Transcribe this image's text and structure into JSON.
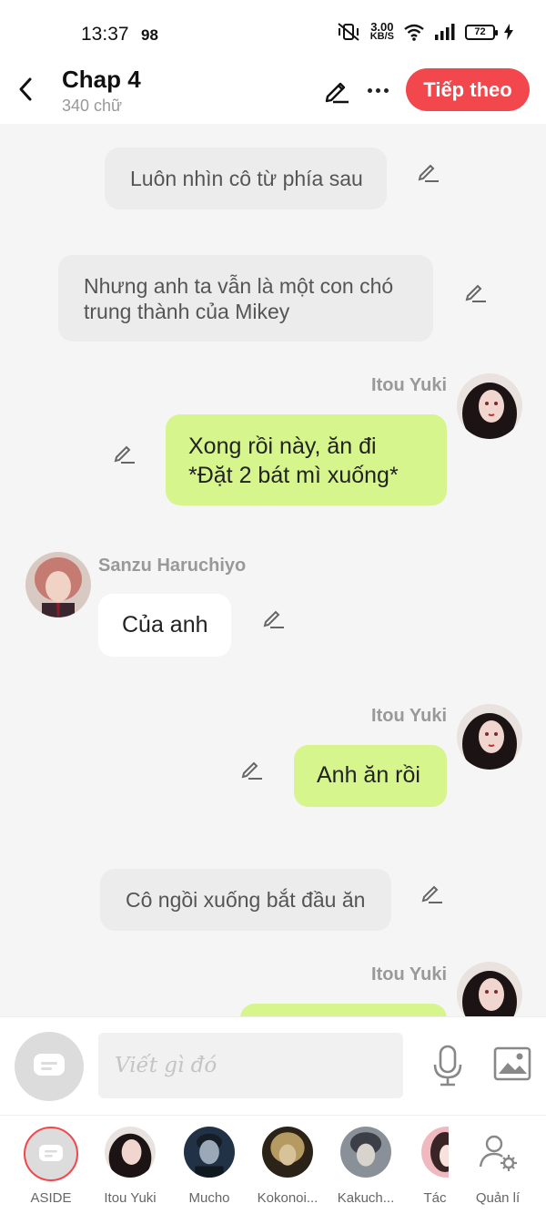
{
  "status_bar": {
    "time": "13:37",
    "indicator": "98",
    "net_speed_value": "3.00",
    "net_speed_unit": "KB/S",
    "battery": "72"
  },
  "header": {
    "title": "Chap 4",
    "subtitle": "340 chữ",
    "next_label": "Tiếp theo"
  },
  "messages": [
    {
      "type": "narration",
      "text": "Luôn nhìn cô từ phía sau"
    },
    {
      "type": "narration",
      "text": "Nhưng anh ta vẫn là một con chó trung thành của Mikey"
    },
    {
      "type": "right",
      "name": "Itou Yuki",
      "text_line1": "Xong rồi này, ăn đi",
      "text_line2": "*Đặt 2 bát mì xuống*"
    },
    {
      "type": "left",
      "name": "Sanzu Haruchiyo",
      "text": "Của anh"
    },
    {
      "type": "right",
      "name": "Itou Yuki",
      "text": "Anh ăn rồi"
    },
    {
      "type": "narration",
      "text": "Cô ngồi xuống bắt đầu ăn"
    },
    {
      "type": "right",
      "name": "Itou Yuki",
      "text": ""
    }
  ],
  "input": {
    "placeholder": "Viết gì đó"
  },
  "characters": [
    {
      "label": "ASIDE"
    },
    {
      "label": "Itou Yuki"
    },
    {
      "label": "Mucho"
    },
    {
      "label": "Kokonoi..."
    },
    {
      "label": "Kakuch..."
    },
    {
      "label": "Tác"
    },
    {
      "label": "Quản lí"
    }
  ],
  "colors": {
    "accent": "#f2484d",
    "bubble_self": "#d7f58d",
    "narration_bg": "#ececec",
    "background": "#f5f5f5"
  }
}
